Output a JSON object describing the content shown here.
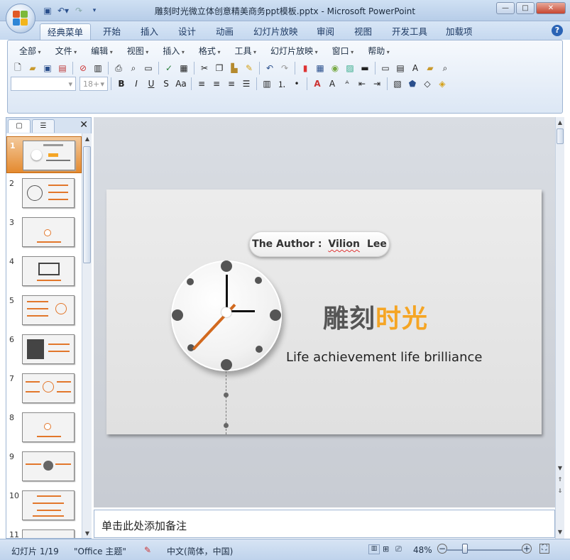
{
  "window": {
    "title": "雕刻时光微立体创意精美商务ppt模板.pptx - Microsoft PowerPoint",
    "minimize_label": "—",
    "maximize_label": "□",
    "close_label": "✕"
  },
  "quick_access": {
    "save_icon": "save-icon",
    "undo_icon": "undo-icon",
    "redo_icon": "redo-icon"
  },
  "ribbon_tabs": [
    "经典菜单",
    "开始",
    "插入",
    "设计",
    "动画",
    "幻灯片放映",
    "审阅",
    "视图",
    "开发工具",
    "加载项"
  ],
  "classic_menus": [
    "全部",
    "文件",
    "编辑",
    "视图",
    "插入",
    "格式",
    "工具",
    "幻灯片放映",
    "窗口",
    "帮助"
  ],
  "format_bar": {
    "font_name": "",
    "font_size": "18+"
  },
  "slide_pane": {
    "slides": [
      "1",
      "2",
      "3",
      "4",
      "5",
      "6",
      "7",
      "8",
      "9",
      "10",
      "11"
    ],
    "selected": "1"
  },
  "slide": {
    "author_prefix": "The Author : ",
    "author_first": "Vilion",
    "author_last": "Lee",
    "title_part1": "雕刻",
    "title_part2": "时光",
    "subtitle": "Life achievement life brilliance"
  },
  "notes": {
    "placeholder": "单击此处添加备注"
  },
  "status": {
    "slide_counter": "幻灯片 1/19",
    "theme": "\"Office 主题\"",
    "language": "中文(简体，中国)",
    "zoom": "48%"
  },
  "colors": {
    "accent_orange": "#f5a524",
    "clock_hand_orange": "#d2691e",
    "ribbon_blue": "#c5d8ef"
  }
}
